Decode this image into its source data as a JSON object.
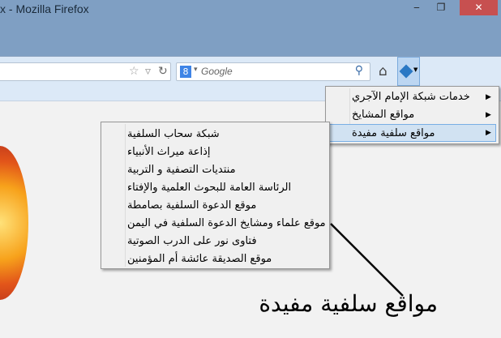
{
  "window": {
    "title": "x - Mozilla Firefox",
    "minimize": "‒",
    "restore": "❐",
    "close": "✕"
  },
  "toolbar": {
    "star": "☆",
    "dropdown": "▿",
    "reload": "↻",
    "search_engine": "8",
    "search_dropdown": "▾",
    "search_placeholder": "Google",
    "search_icon": "⚲",
    "home": "⌂",
    "addon_dropdown": "▼"
  },
  "menu": {
    "items": [
      {
        "label": "خدمات شبكة الإمام الآجري",
        "has_submenu": true
      },
      {
        "label": "مواقع المشايخ",
        "has_submenu": true
      },
      {
        "label": "مواقع سلفية مفيدة",
        "has_submenu": true,
        "selected": true
      }
    ],
    "arrow": "▶"
  },
  "submenu": {
    "items": [
      "شبكة سحاب السلفية",
      "إذاعة ميراث الأنبياء",
      "منتديات التصفية و التربية",
      "الرئاسة العامة للبحوث العلمية والإفتاء",
      "موقع الدعوة السلفية بصامطة",
      "موقع علماء ومشايخ الدعوة السلفية في اليمن",
      "فتاوى نور على الدرب الصوتية",
      "موقع الصديقة عائشة أم المؤمنين"
    ]
  },
  "annotation": {
    "text": "مواقع سلفية مفيدة"
  }
}
